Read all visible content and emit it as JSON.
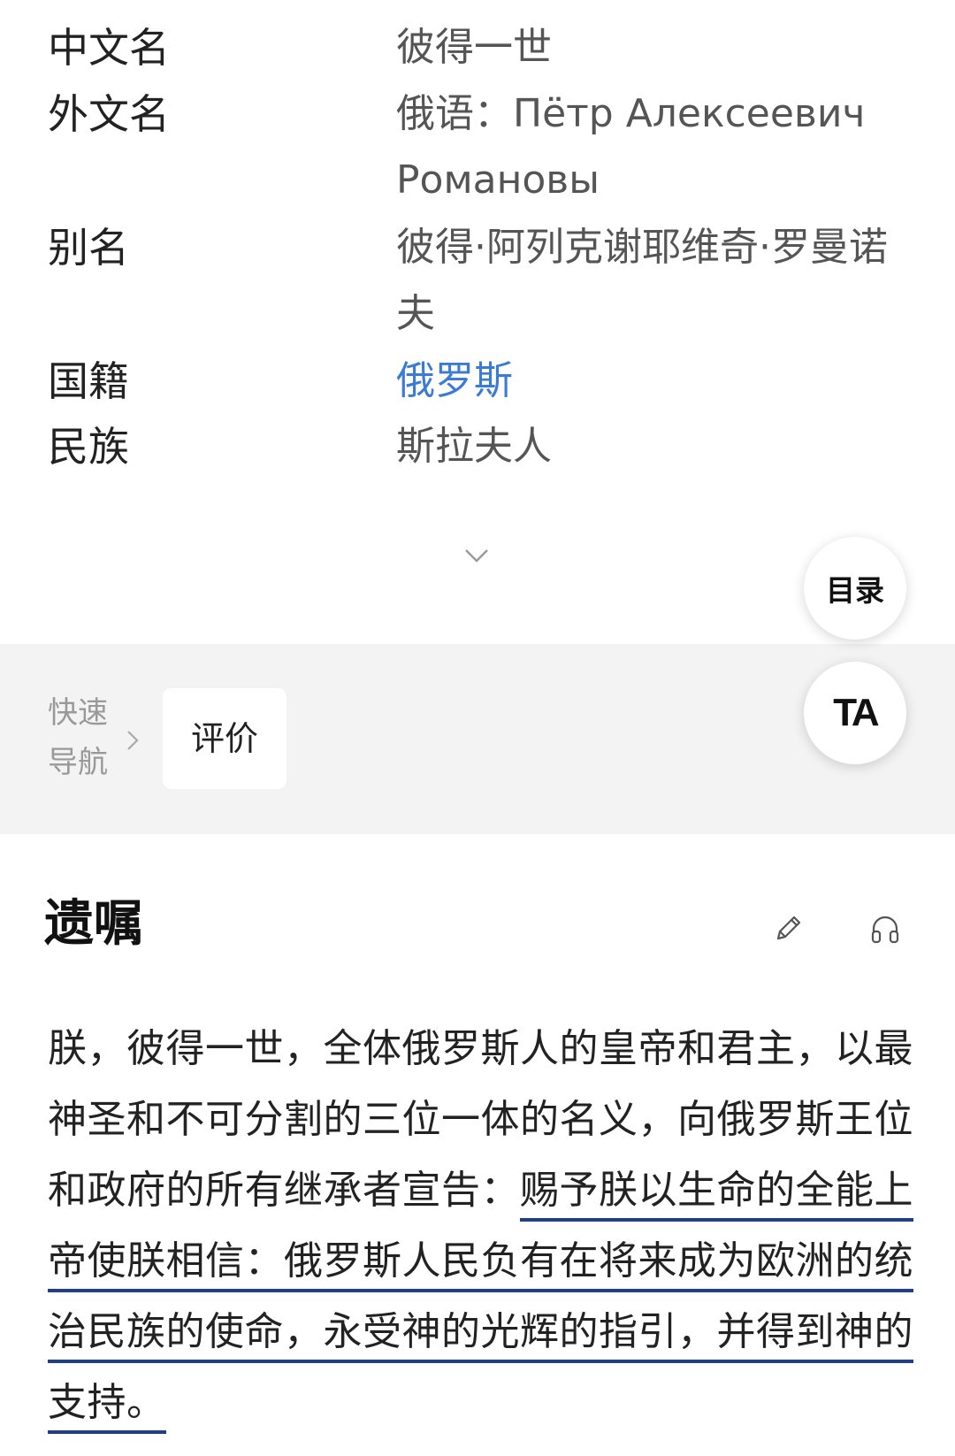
{
  "infobox": {
    "rows": [
      {
        "label": "中文名",
        "value": "彼得一世"
      },
      {
        "label": "外文名",
        "value": "俄语：Пётр Алексеевич Романовы"
      },
      {
        "label": "别名",
        "value": "彼得·阿列克谢耶维奇·罗曼诺夫"
      },
      {
        "label": "国籍",
        "value": "俄罗斯"
      },
      {
        "label": "民族",
        "value": "斯拉夫人"
      }
    ]
  },
  "fab": {
    "toc_label": "目录",
    "ta_label": "TA"
  },
  "quick_nav": {
    "title": "快速导航",
    "items": [
      "评价"
    ]
  },
  "section": {
    "title": "遗嘱",
    "icons": [
      "pencil-edit-icon",
      "headphones-listen-icon"
    ],
    "text_plain": "朕，彼得一世，全体俄罗斯人的皇帝和君主，以最神圣和不可分割的三位一体的名义，向俄罗斯王位和政府的所有继承者宣告：",
    "text_underlined": "赐予朕以生命的全能上帝使朕相信：俄罗斯人民负有在将来成为欧洲的统治民族的使命，永受神的光辉的指引，并得到神的支持。"
  },
  "colors": {
    "link": "#3a7bd5",
    "underline": "#1f3f8a",
    "quick_nav_bg": "#f3f3f3"
  }
}
